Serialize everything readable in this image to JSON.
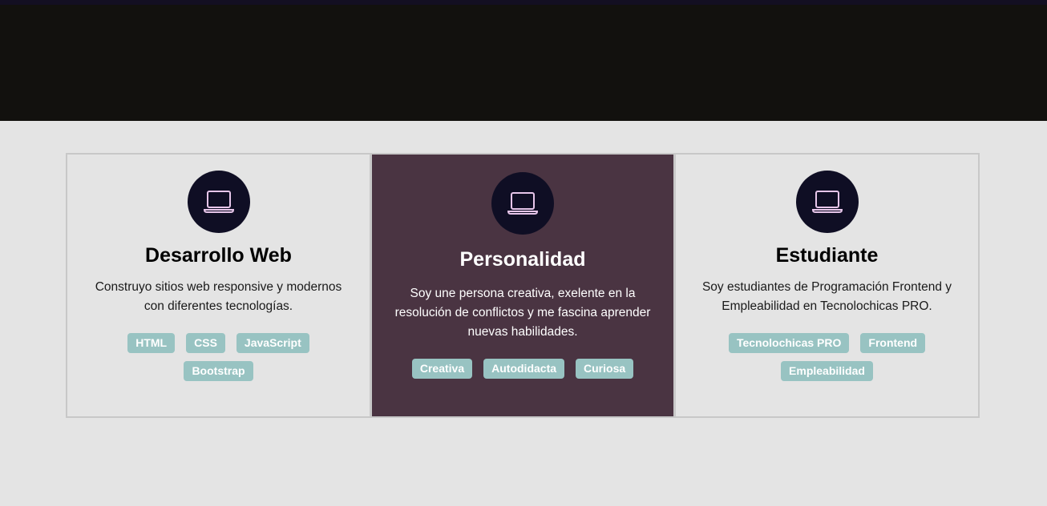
{
  "colors": {
    "hero_bg": "#12110e",
    "page_bg": "#e4e4e4",
    "highlight_card_bg": "#4a3442",
    "icon_circle_bg": "#0f0e24",
    "icon_stroke": "#e7c6ea",
    "tag_bg": "#98c3c2"
  },
  "cards": [
    {
      "icon": "laptop-icon",
      "title": "Desarrollo Web",
      "text": "Construyo sitios web responsive y modernos con diferentes tecnologías.",
      "tags": [
        "HTML",
        "CSS",
        "JavaScript",
        "Bootstrap"
      ]
    },
    {
      "icon": "laptop-icon",
      "title": "Personalidad",
      "text": "Soy une persona creativa, exelente en la resolución de conflictos y me fascina aprender nuevas habilidades.",
      "tags": [
        "Creativa",
        "Autodidacta",
        "Curiosa"
      ]
    },
    {
      "icon": "laptop-icon",
      "title": "Estudiante",
      "text": "Soy estudiantes de Programación Frontend y Empleabilidad en Tecnolochicas PRO.",
      "tags": [
        "Tecnolochicas PRO",
        "Frontend",
        "Empleabilidad"
      ]
    }
  ]
}
